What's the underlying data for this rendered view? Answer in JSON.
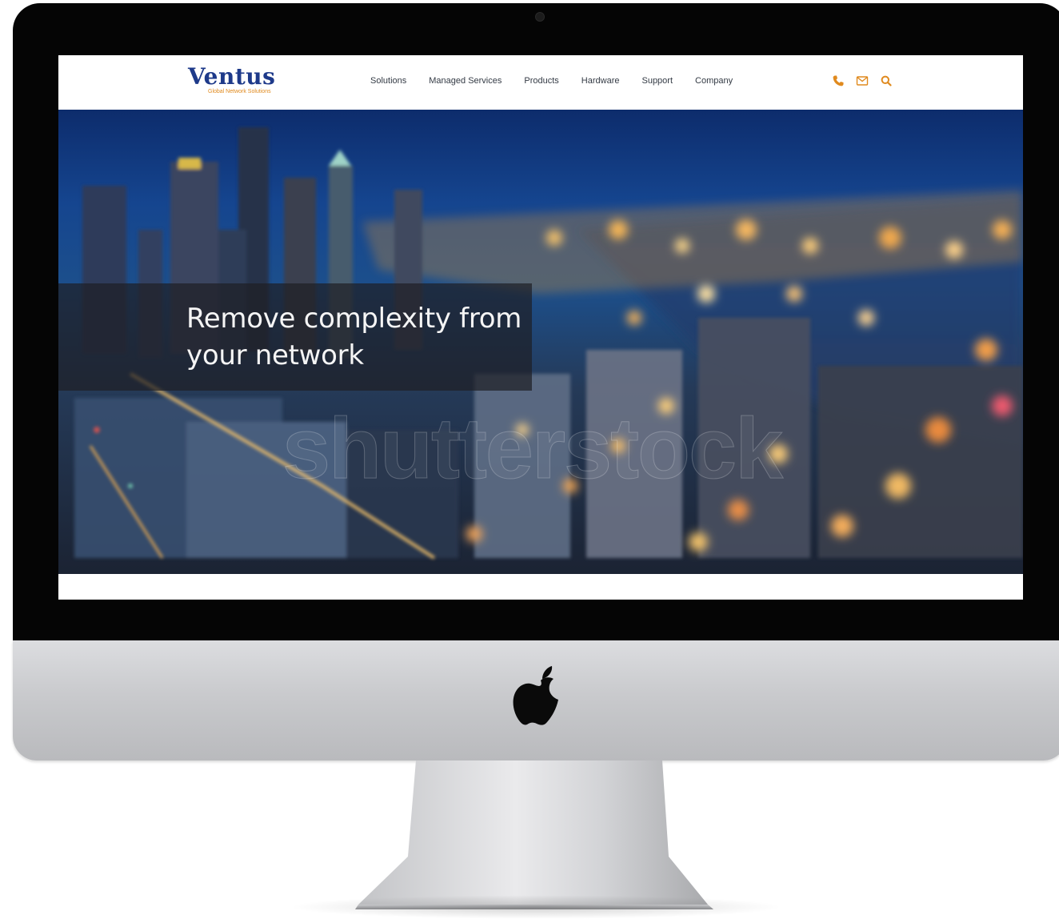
{
  "site": {
    "logo": {
      "name": "Ventus",
      "tagline": "Global Network Solutions"
    },
    "nav": [
      {
        "label": "Solutions"
      },
      {
        "label": "Managed Services"
      },
      {
        "label": "Products"
      },
      {
        "label": "Hardware"
      },
      {
        "label": "Support"
      },
      {
        "label": "Company"
      }
    ],
    "header_icons": [
      "phone-icon",
      "mail-icon",
      "search-icon"
    ],
    "accent_color": "#e08a1e",
    "logo_color": "#1e3a8a"
  },
  "hero": {
    "headline": "Remove complexity from your network",
    "watermark": "shutterstock",
    "image": "blurred night city skyline with bokeh lights"
  },
  "device": {
    "type": "iMac",
    "logo": "apple-logo"
  }
}
